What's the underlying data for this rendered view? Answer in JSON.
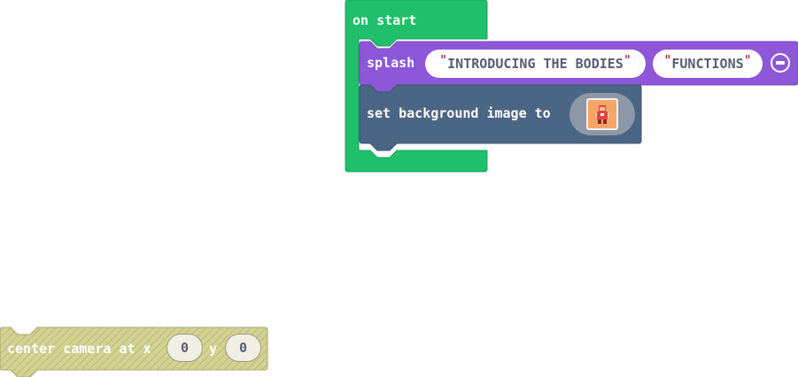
{
  "workspace": {
    "on_start": {
      "label": "on start",
      "color": "#20bf6b"
    },
    "splash": {
      "label": "splash",
      "color": "#8e57d9",
      "arg1": "INTRODUCING THE BODIES",
      "arg2": "FUNCTIONS",
      "quote": "\"",
      "remove_icon": "minus-circle-icon"
    },
    "set_background": {
      "label": "set background image to",
      "color": "#4b6584",
      "image": "red-character-image"
    },
    "center_camera": {
      "label_a": "center camera at x",
      "label_b": "y",
      "x_value": "0",
      "y_value": "0",
      "color": "#d0cf8d",
      "state": "disabled"
    }
  }
}
